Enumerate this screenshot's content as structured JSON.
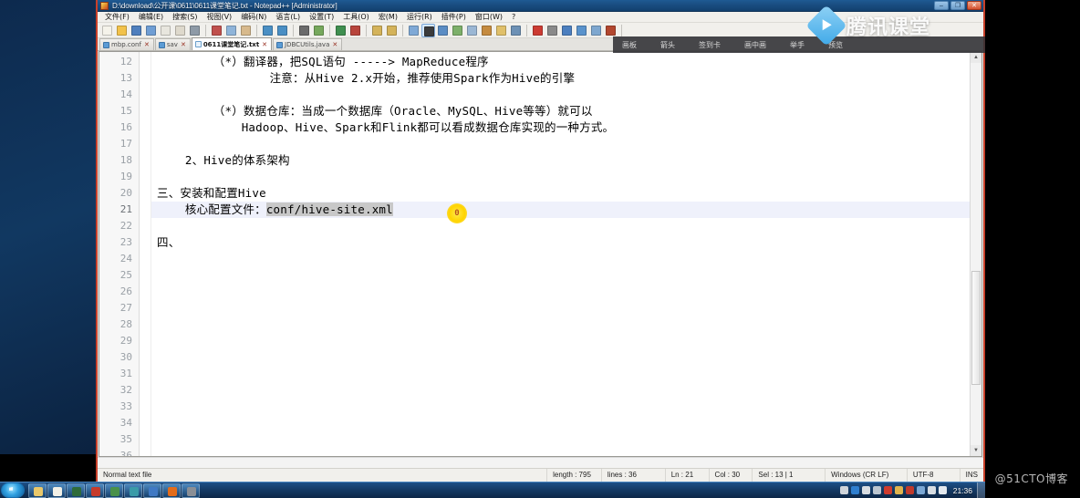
{
  "window": {
    "title": "D:\\download\\公开课\\0611\\0611课堂笔记.txt - Notepad++ [Administrator]",
    "minimize_label": "–",
    "maximize_label": "❐",
    "close_label": "✕"
  },
  "menu": {
    "items": [
      {
        "label": "文件(F)"
      },
      {
        "label": "编辑(E)"
      },
      {
        "label": "搜索(S)"
      },
      {
        "label": "视图(V)"
      },
      {
        "label": "编码(N)"
      },
      {
        "label": "语言(L)"
      },
      {
        "label": "设置(T)"
      },
      {
        "label": "工具(O)"
      },
      {
        "label": "宏(M)"
      },
      {
        "label": "运行(R)"
      },
      {
        "label": "插件(P)"
      },
      {
        "label": "窗口(W)"
      },
      {
        "label": "?"
      }
    ]
  },
  "toolbar": {
    "buttons": [
      {
        "name": "new-file-icon",
        "color": "#f5f3ea"
      },
      {
        "name": "open-file-icon",
        "color": "#f2c24a"
      },
      {
        "name": "save-icon",
        "color": "#4f7fbd"
      },
      {
        "name": "save-all-icon",
        "color": "#6f9ed4"
      },
      {
        "name": "close-file-icon",
        "color": "#e8e6de"
      },
      {
        "name": "close-all-icon",
        "color": "#ded9cc"
      },
      {
        "name": "print-icon",
        "color": "#8e9aa6"
      },
      {
        "name": "cut-icon",
        "color": "#c0504d"
      },
      {
        "name": "copy-icon",
        "color": "#8fb4d9"
      },
      {
        "name": "paste-icon",
        "color": "#d7b98c"
      },
      {
        "name": "undo-icon",
        "color": "#4a8fc4"
      },
      {
        "name": "redo-icon",
        "color": "#4a8fc4"
      },
      {
        "name": "find-icon",
        "color": "#6b6b6b"
      },
      {
        "name": "replace-icon",
        "color": "#76a85c"
      },
      {
        "name": "zoom-in-icon",
        "color": "#3f8f4f"
      },
      {
        "name": "zoom-out-icon",
        "color": "#b8453c"
      },
      {
        "name": "sync-scroll-v-icon",
        "color": "#d4b35a"
      },
      {
        "name": "sync-scroll-h-icon",
        "color": "#d4b35a"
      },
      {
        "name": "word-wrap-icon",
        "color": "#7fa9d6"
      },
      {
        "name": "all-chars-icon",
        "color": "#3b3b3b"
      },
      {
        "name": "indent-guide-icon",
        "color": "#5b8dc4"
      },
      {
        "name": "user-lang-icon",
        "color": "#7db06a"
      },
      {
        "name": "doc-map-icon",
        "color": "#9bb7d4"
      },
      {
        "name": "func-list-icon",
        "color": "#c58b3f"
      },
      {
        "name": "folder-workspace-icon",
        "color": "#e0c06a"
      },
      {
        "name": "monitor-icon",
        "color": "#6d91b5"
      },
      {
        "name": "macro-record-icon",
        "color": "#cc3b32"
      },
      {
        "name": "macro-stop-icon",
        "color": "#8a8a8a"
      },
      {
        "name": "macro-play-icon",
        "color": "#4c7fbf"
      },
      {
        "name": "macro-multi-icon",
        "color": "#5a93cc"
      },
      {
        "name": "macro-save-icon",
        "color": "#7ea7cf"
      },
      {
        "name": "plugin-icon",
        "color": "#b2472f"
      }
    ]
  },
  "tabs": [
    {
      "label": "mbp.conf",
      "selected": false,
      "close": "✕"
    },
    {
      "label": "sav",
      "selected": false,
      "close": "✕"
    },
    {
      "label": "0611课堂笔记.txt",
      "selected": true,
      "close": "✕"
    },
    {
      "label": "JDBCUtils.java",
      "selected": false,
      "close": "✕"
    }
  ],
  "editor": {
    "lines": [
      {
        "num": "12",
        "text": "        （*）翻译器，把SQL语句 -----> MapReduce程序",
        "highlight": false
      },
      {
        "num": "13",
        "text": "                注意：从Hive 2.x开始，推荐使用Spark作为Hive的引擎",
        "highlight": false
      },
      {
        "num": "14",
        "text": "",
        "highlight": false
      },
      {
        "num": "15",
        "text": "        （*）数据仓库：当成一个数据库（Oracle、MySQL、Hive等等）就可以",
        "highlight": false
      },
      {
        "num": "16",
        "text": "            Hadoop、Hive、Spark和Flink都可以看成数据仓库实现的一种方式。",
        "highlight": false
      },
      {
        "num": "17",
        "text": "",
        "highlight": false
      },
      {
        "num": "18",
        "text": "    2、Hive的体系架构",
        "highlight": false
      },
      {
        "num": "19",
        "text": "",
        "highlight": false
      },
      {
        "num": "20",
        "text": "三、安装和配置Hive",
        "highlight": false
      },
      {
        "num": "21",
        "text": "    核心配置文件：",
        "selected_text": "conf/hive-site.xml",
        "highlight": true
      },
      {
        "num": "22",
        "text": "",
        "highlight": false
      },
      {
        "num": "23",
        "text": "四、",
        "highlight": false
      },
      {
        "num": "24",
        "text": "",
        "highlight": false
      },
      {
        "num": "25",
        "text": "",
        "highlight": false
      },
      {
        "num": "26",
        "text": "",
        "highlight": false
      },
      {
        "num": "27",
        "text": "",
        "highlight": false
      },
      {
        "num": "28",
        "text": "",
        "highlight": false
      },
      {
        "num": "29",
        "text": "",
        "highlight": false
      },
      {
        "num": "30",
        "text": "",
        "highlight": false
      },
      {
        "num": "31",
        "text": "",
        "highlight": false
      },
      {
        "num": "32",
        "text": "",
        "highlight": false
      },
      {
        "num": "33",
        "text": "",
        "highlight": false
      },
      {
        "num": "34",
        "text": "",
        "highlight": false
      },
      {
        "num": "35",
        "text": "",
        "highlight": false
      },
      {
        "num": "36",
        "text": "",
        "highlight": false
      }
    ],
    "cursor_marker": "0",
    "scroll_up_arrow": "▲",
    "scroll_down_arrow": "▼"
  },
  "statusbar": {
    "file_type": "Normal text file",
    "length": "length : 795",
    "lines": "lines : 36",
    "ln": "Ln : 21",
    "col": "Col : 30",
    "sel": "Sel : 13 | 1",
    "eol": "Windows (CR LF)",
    "encoding": "UTF-8",
    "insert_mode": "INS"
  },
  "overlay": {
    "brand_text": "腾讯课堂",
    "logo_name": "play-button-logo",
    "tools": [
      {
        "label": "画板"
      },
      {
        "label": "箭头"
      },
      {
        "label": "签到卡"
      },
      {
        "label": "画中画"
      },
      {
        "label": "举手"
      },
      {
        "label": "预览"
      }
    ]
  },
  "taskbar": {
    "start_label": "开始",
    "quick_launch": [
      {
        "name": "taskbar-explorer-icon",
        "color": "#e9c86a"
      },
      {
        "name": "taskbar-notepad-icon",
        "color": "#f2f0e6"
      },
      {
        "name": "taskbar-terminal-icon",
        "color": "#2e6b3a"
      },
      {
        "name": "taskbar-app-red-icon",
        "color": "#c63b2b"
      },
      {
        "name": "taskbar-app-green-icon",
        "color": "#49914a"
      },
      {
        "name": "taskbar-app-teal-icon",
        "color": "#3a9ba8"
      },
      {
        "name": "taskbar-app-blue-icon",
        "color": "#3f79c4"
      },
      {
        "name": "taskbar-firefox-icon",
        "color": "#e36c1a"
      },
      {
        "name": "taskbar-app-gray-icon",
        "color": "#8a8f96"
      }
    ],
    "tray": [
      {
        "name": "tray-printer-icon",
        "color": "#cfd4da"
      },
      {
        "name": "tray-help-icon",
        "color": "#2f7fd0"
      },
      {
        "name": "tray-updates-icon",
        "color": "#d8dde2"
      },
      {
        "name": "tray-arrow-icon",
        "color": "#bcc6d0"
      },
      {
        "name": "tray-antivirus-icon",
        "color": "#cf3b2e"
      },
      {
        "name": "tray-explorer-icon",
        "color": "#e0b44e"
      },
      {
        "name": "tray-input-icon",
        "color": "#c0392b"
      },
      {
        "name": "tray-app-icon",
        "color": "#7aa7d4"
      },
      {
        "name": "tray-network-icon",
        "color": "#d7dde3"
      },
      {
        "name": "tray-volume-icon",
        "color": "#e3e9ef"
      }
    ],
    "clock": "21:36"
  },
  "watermark": {
    "text": "@51CTO博客"
  }
}
